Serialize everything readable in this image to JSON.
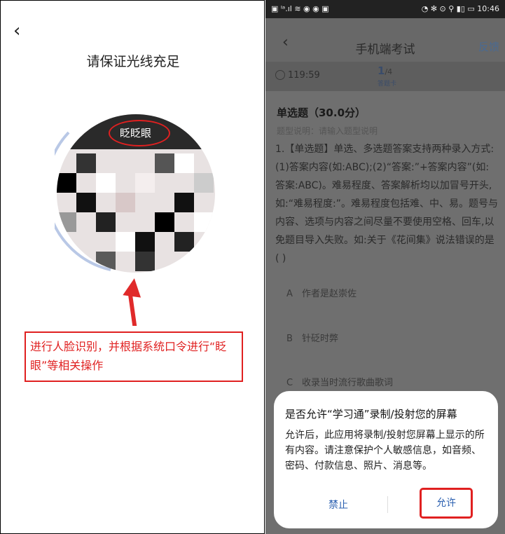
{
  "left_panel": {
    "back_icon": "chevron-left-icon",
    "title": "请保证光线充足",
    "blink_label": "眨眨眼",
    "note": "进行人脸识别，并根据系统口令进行“眨眼”等相关操作"
  },
  "right_panel": {
    "status_left": "▣ ᴵᵃ.ıl ≋ ◉ ◉ ▣",
    "status_right": "◔ ✻ ⊙ ⚲ ▮▯ ▭ 10:46",
    "back_icon": "chevron-left-icon",
    "title": "手机端考试",
    "feedback": "反馈",
    "timer": "119:59",
    "progress_current": "1",
    "progress_total": "/4",
    "answer_card": "答题卡",
    "question_type": "单选题（30.0分）",
    "question_desc": "题型说明：请输入题型说明",
    "question_text": "1.【单选题】单选、多选题答案支持两种录入方式:(1)答案内容(如:ABC);(2)“答案:”+答案内容”(如:答案:ABC)。难易程度、答案解析均以加冒号开头,如:“难易程度:”。难易程度包括难、中、易。题号与内容、选项与内容之间尽量不要使用空格、回车,以免题目导入失败。如:关于《花间集》说法错误的是( )",
    "options": [
      {
        "key": "A",
        "text": "作者是赵崇佐"
      },
      {
        "key": "B",
        "text": "针砭时弊"
      },
      {
        "key": "C",
        "text": "收录当时流行歌曲歌词"
      }
    ],
    "dialog": {
      "title": "是否允许“学习通”录制/投射您的屏幕",
      "body": "允许后，此应用将录制/投射您屏幕上显示的所有内容。请注意保护个人敏感信息，如音频、密码、付款信息、照片、消息等。",
      "deny": "禁止",
      "allow": "允许"
    }
  },
  "colors": {
    "highlight": "#e02020",
    "link": "#2a5fb0"
  }
}
